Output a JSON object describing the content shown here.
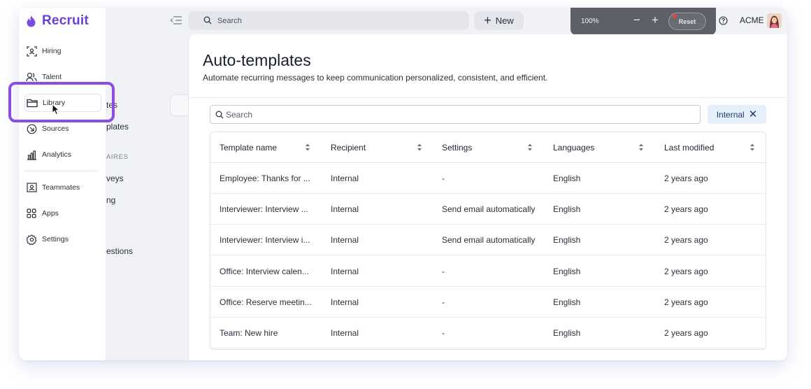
{
  "brand": {
    "name": "Recruit",
    "accent": "#6b3fd4"
  },
  "nav": {
    "items": [
      {
        "label": "Hiring",
        "icon": "scan-user-icon"
      },
      {
        "label": "Talent",
        "icon": "people-icon"
      },
      {
        "label": "Library",
        "icon": "folder-icon"
      },
      {
        "label": "Sources",
        "icon": "circle-arrow-icon"
      },
      {
        "label": "Analytics",
        "icon": "bar-chart-icon"
      },
      {
        "label": "Teammates",
        "icon": "id-card-icon"
      },
      {
        "label": "Apps",
        "icon": "grid-icon"
      },
      {
        "label": "Settings",
        "icon": "gear-icon"
      }
    ]
  },
  "subnav": {
    "items": [
      "tes",
      "plates",
      "veys",
      "ng",
      "estions"
    ],
    "section_label": "AIRES"
  },
  "topbar": {
    "search_placeholder": "Search",
    "new_label": "New",
    "zoom": "100%",
    "reset_label": "Reset",
    "org": "ACME"
  },
  "page": {
    "title": "Auto-templates",
    "subtitle": "Automate recurring messages to keep communication personalized, consistent, and efficient."
  },
  "filters": {
    "search_placeholder": "Search",
    "chip": "Internal"
  },
  "table": {
    "columns": [
      "Template name",
      "Recipient",
      "Settings",
      "Languages",
      "Last modified"
    ],
    "rows": [
      [
        "Employee: Thanks for ...",
        "Internal",
        "-",
        "English",
        "2 years ago"
      ],
      [
        "Interviewer: Interview ...",
        "Internal",
        "Send email automatically",
        "English",
        "2 years ago"
      ],
      [
        "Interviewer: Interview i...",
        "Internal",
        "Send email automatically",
        "English",
        "2 years ago"
      ],
      [
        "Office: Interview calen...",
        "Internal",
        "-",
        "English",
        "2 years ago"
      ],
      [
        "Office: Reserve meetin...",
        "Internal",
        "-",
        "English",
        "2 years ago"
      ],
      [
        "Team: New hire",
        "Internal",
        "-",
        "English",
        "2 years ago"
      ]
    ]
  }
}
